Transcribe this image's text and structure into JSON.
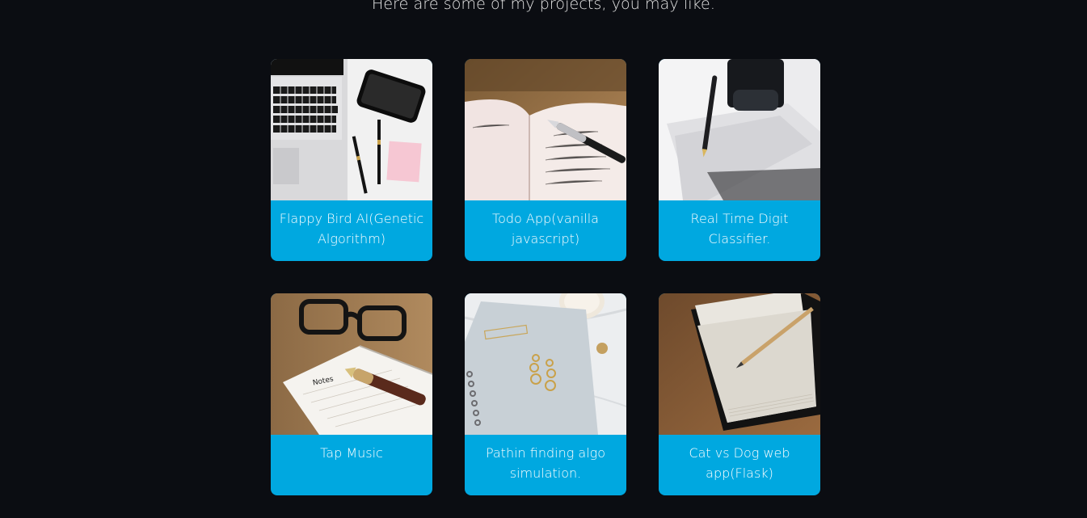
{
  "intro": {
    "text": "Here are some of my projects, you may like."
  },
  "projects": [
    {
      "title": "Flappy Bird AI(Genetic Algorithm)",
      "image_icon": "laptop-phone-desk-photo"
    },
    {
      "title": "Todo App(vanilla javascript)",
      "image_icon": "open-notebook-pen-photo"
    },
    {
      "title": "Real Time Digit Classifier.",
      "image_icon": "ink-pen-paper-photo"
    },
    {
      "title": "Tap Music",
      "image_icon": "glasses-notebook-photo"
    },
    {
      "title": "Pathin finding algo simulation.",
      "image_icon": "notebook-earrings-photo"
    },
    {
      "title": "Cat vs Dog web app(Flask)",
      "image_icon": "notebook-pencil-photo"
    }
  ],
  "colors": {
    "background": "#0b0d12",
    "card_accent": "#00a8e0",
    "text": "#ffffff"
  }
}
